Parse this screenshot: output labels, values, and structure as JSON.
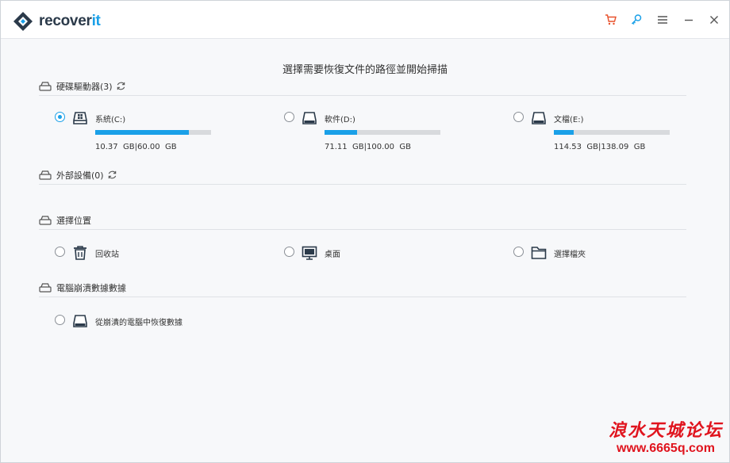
{
  "app": {
    "name_main": "recover",
    "name_accent": "it"
  },
  "toolbar": {
    "cart_icon": "cart-icon",
    "key_icon": "key-icon",
    "menu_icon": "menu-icon",
    "minimize_icon": "minimize-icon",
    "close_icon": "close-icon"
  },
  "main": {
    "title": "選擇需要恢復文件的路徑並開始掃描"
  },
  "sections": {
    "drives": {
      "label": "硬碟驅動器(3)",
      "items": [
        {
          "name": "系統(C:)",
          "used": "10.37",
          "total": "60.00",
          "unit": "GB",
          "fill": 0.81,
          "selected": true
        },
        {
          "name": "軟件(D:)",
          "used": "71.11",
          "total": "100.00",
          "unit": "GB",
          "fill": 0.28,
          "selected": false
        },
        {
          "name": "文檔(E:)",
          "used": "114.53",
          "total": "138.09",
          "unit": "GB",
          "fill": 0.17,
          "selected": false
        }
      ]
    },
    "external": {
      "label": "外部設備(0)"
    },
    "location": {
      "label": "選擇位置",
      "items": [
        {
          "name": "回收站",
          "icon": "recycle-bin-icon"
        },
        {
          "name": "桌面",
          "icon": "desktop-icon"
        },
        {
          "name": "選擇檔夾",
          "icon": "folder-icon"
        }
      ]
    },
    "crashed": {
      "label": "電腦崩潰數據數據",
      "items": [
        {
          "name": "從崩潰的電腦中恢復數據",
          "icon": "crashed-drive-icon"
        }
      ]
    }
  },
  "watermark": {
    "line1": "浪水天城论坛",
    "line2": "www.6665q.com"
  },
  "colors": {
    "accent": "#1aa0e8",
    "cart": "#e8502a",
    "watermark": "#e0141e"
  }
}
